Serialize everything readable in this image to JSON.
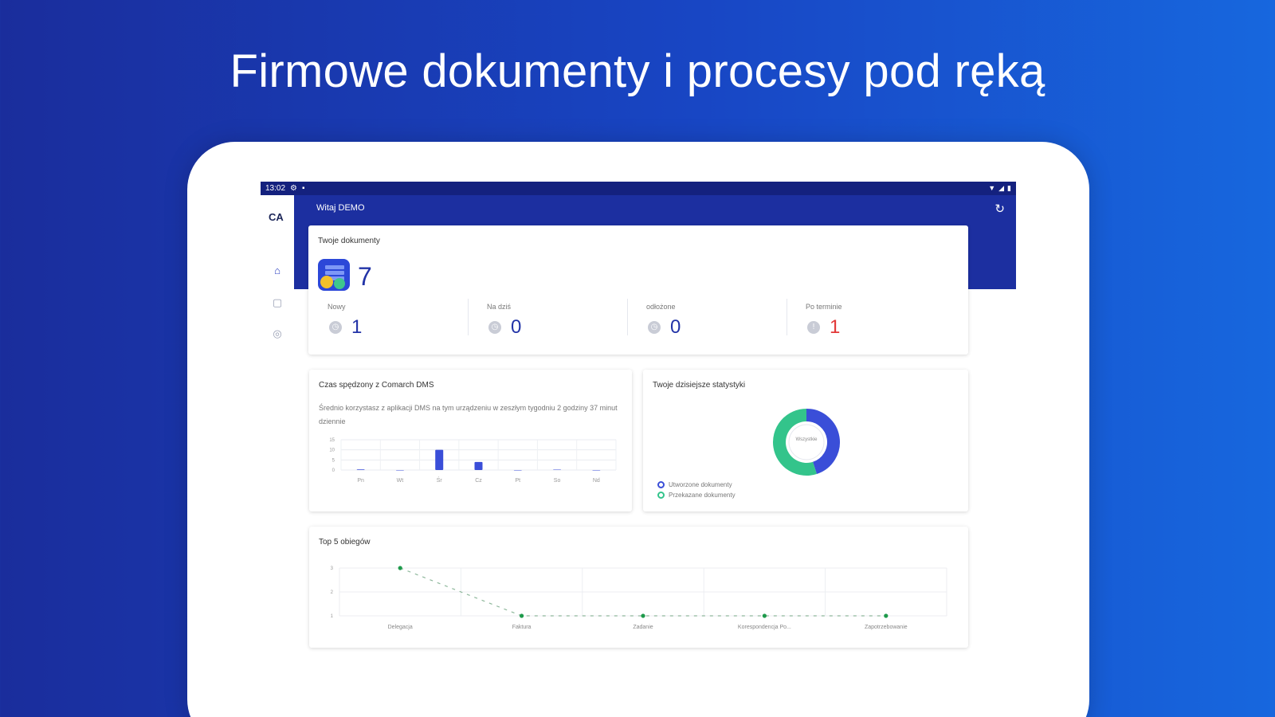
{
  "headline": "Firmowe dokumenty i procesy pod ręką",
  "status_bar": {
    "time": "13:02"
  },
  "app_bar": {
    "title": "Witaj DEMO"
  },
  "rail": {
    "logo": "CA"
  },
  "docs_card": {
    "title": "Twoje dokumenty",
    "total": "7",
    "stats": [
      {
        "label": "Nowy",
        "value": "1",
        "color": "#2233a7"
      },
      {
        "label": "Na dziś",
        "value": "0",
        "color": "#2233a7"
      },
      {
        "label": "odłożone",
        "value": "0",
        "color": "#2233a7"
      },
      {
        "label": "Po terminie",
        "value": "1",
        "color": "#e23737"
      }
    ]
  },
  "usage_card": {
    "title": "Czas spędzony z Comarch DMS",
    "description": "Średnio korzystasz z aplikacji DMS na tym urządzeniu w zeszłym tygodniu 2 godziny 37 minut dziennie"
  },
  "stats_card": {
    "title": "Twoje dzisiejsze statystyki",
    "center_label": "Wszystkie",
    "legend": [
      "Utworzone dokumenty",
      "Przekazane dokumenty"
    ]
  },
  "top_card": {
    "title": "Top 5 obiegów"
  },
  "chart_data": [
    {
      "type": "bar",
      "categories": [
        "Pn",
        "Wt",
        "Śr",
        "Cz",
        "Pt",
        "So",
        "Nd"
      ],
      "values": [
        0.3,
        0,
        10,
        4,
        0,
        0.2,
        0
      ],
      "ylim": [
        0,
        15
      ],
      "yticks": [
        "15",
        "10",
        "5",
        "0"
      ],
      "grid": true,
      "color": "#3a4ed8"
    },
    {
      "type": "pie",
      "labels": [
        "Utworzone dokumenty",
        "Przekazane dokumenty"
      ],
      "values": [
        45,
        55
      ],
      "colors": [
        "#3a4ed8",
        "#33c48b"
      ],
      "donut": true
    },
    {
      "type": "line",
      "categories": [
        "Delegacja",
        "Faktura",
        "Zadanie",
        "Korespondencja Po...",
        "Zapotrzebowanie"
      ],
      "values": [
        3,
        1,
        1,
        1,
        1
      ],
      "ylim": [
        1,
        3
      ],
      "yticks": [
        "3",
        "2",
        "1"
      ],
      "grid": true,
      "color": "#1e9a4b"
    }
  ]
}
